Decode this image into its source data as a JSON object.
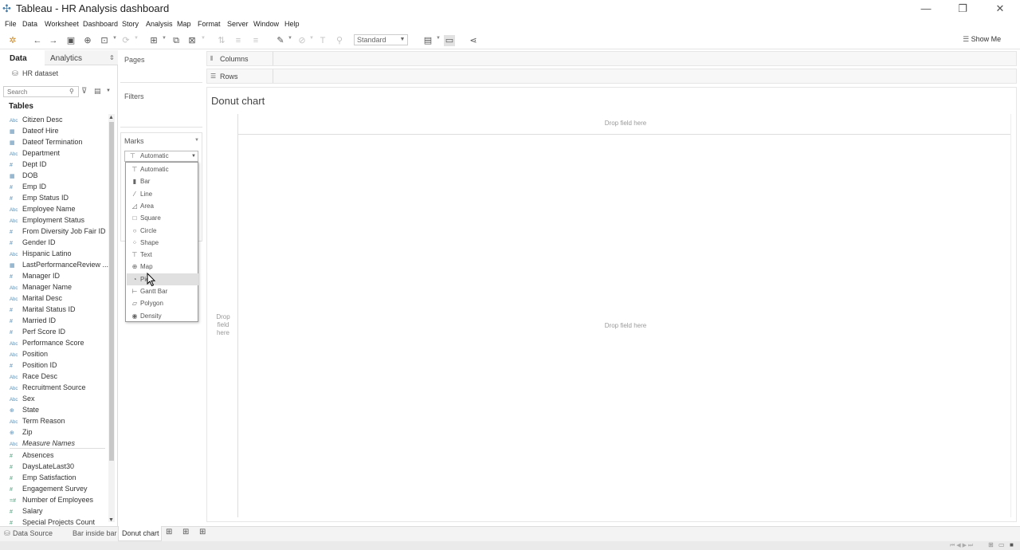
{
  "window": {
    "title": "Tableau - HR Analysis dashboard",
    "minimize_icon": "minimize-icon",
    "restore_icon": "restore-icon",
    "close_icon": "close-icon"
  },
  "menu": [
    "File",
    "Data",
    "Worksheet",
    "Dashboard",
    "Story",
    "Analysis",
    "Map",
    "Format",
    "Server",
    "Window",
    "Help"
  ],
  "toolbar": {
    "fit_value": "Standard",
    "show_me": "Show Me"
  },
  "data_pane": {
    "tab_data": "Data",
    "tab_analytics": "Analytics",
    "data_source": "HR dataset",
    "search_placeholder": "Search",
    "tables_heading": "Tables",
    "dimensions": [
      {
        "type": "Abc",
        "name": "Citizen Desc"
      },
      {
        "type": "date",
        "name": "Dateof Hire"
      },
      {
        "type": "date",
        "name": "Dateof Termination"
      },
      {
        "type": "Abc",
        "name": "Department"
      },
      {
        "type": "#",
        "name": "Dept ID"
      },
      {
        "type": "date",
        "name": "DOB"
      },
      {
        "type": "#",
        "name": "Emp ID"
      },
      {
        "type": "#",
        "name": "Emp Status ID"
      },
      {
        "type": "Abc",
        "name": "Employee Name"
      },
      {
        "type": "Abc",
        "name": "Employment Status"
      },
      {
        "type": "#",
        "name": "From Diversity Job Fair ID"
      },
      {
        "type": "#",
        "name": "Gender ID"
      },
      {
        "type": "Abc",
        "name": "Hispanic Latino"
      },
      {
        "type": "date",
        "name": "LastPerformanceReview ..."
      },
      {
        "type": "#",
        "name": "Manager ID"
      },
      {
        "type": "Abc",
        "name": "Manager Name"
      },
      {
        "type": "Abc",
        "name": "Marital Desc"
      },
      {
        "type": "#",
        "name": "Marital Status ID"
      },
      {
        "type": "#",
        "name": "Married ID"
      },
      {
        "type": "#",
        "name": "Perf Score ID"
      },
      {
        "type": "Abc",
        "name": "Performance Score"
      },
      {
        "type": "Abc",
        "name": "Position"
      },
      {
        "type": "#",
        "name": "Position ID"
      },
      {
        "type": "Abc",
        "name": "Race Desc"
      },
      {
        "type": "Abc",
        "name": "Recruitment Source"
      },
      {
        "type": "Abc",
        "name": "Sex"
      },
      {
        "type": "geo",
        "name": "State"
      },
      {
        "type": "Abc",
        "name": "Term Reason"
      },
      {
        "type": "geo",
        "name": "Zip"
      },
      {
        "type": "Abc",
        "name": "Measure Names"
      }
    ],
    "measures": [
      {
        "type": "#",
        "name": "Absences"
      },
      {
        "type": "#",
        "name": "DaysLateLast30"
      },
      {
        "type": "#",
        "name": "Emp Satisfaction"
      },
      {
        "type": "#",
        "name": "Engagement Survey"
      },
      {
        "type": "=#",
        "name": "Number of Employees"
      },
      {
        "type": "#",
        "name": "Salary"
      },
      {
        "type": "#",
        "name": "Special Projects Count"
      }
    ]
  },
  "cards": {
    "pages": "Pages",
    "filters": "Filters",
    "marks": "Marks",
    "mark_type_selected": "Automatic",
    "mark_types": [
      {
        "icon": "T",
        "label": "Automatic"
      },
      {
        "icon": "bar",
        "label": "Bar"
      },
      {
        "icon": "line",
        "label": "Line"
      },
      {
        "icon": "area",
        "label": "Area"
      },
      {
        "icon": "square",
        "label": "Square"
      },
      {
        "icon": "circle",
        "label": "Circle"
      },
      {
        "icon": "shape",
        "label": "Shape"
      },
      {
        "icon": "T",
        "label": "Text"
      },
      {
        "icon": "map",
        "label": "Map"
      },
      {
        "icon": "pie",
        "label": "Pie"
      },
      {
        "icon": "gantt",
        "label": "Gantt Bar"
      },
      {
        "icon": "polygon",
        "label": "Polygon"
      },
      {
        "icon": "density",
        "label": "Density"
      }
    ],
    "highlighted_mark": "Pie"
  },
  "shelves": {
    "columns": "Columns",
    "rows": "Rows"
  },
  "sheet": {
    "title": "Donut chart",
    "drop_top": "Drop field here",
    "drop_center": "Drop field here",
    "drop_left": "Drop field here"
  },
  "tabs": {
    "data_source": "Data Source",
    "sheet1": "Bar inside bar",
    "sheet2": "Donut chart"
  }
}
